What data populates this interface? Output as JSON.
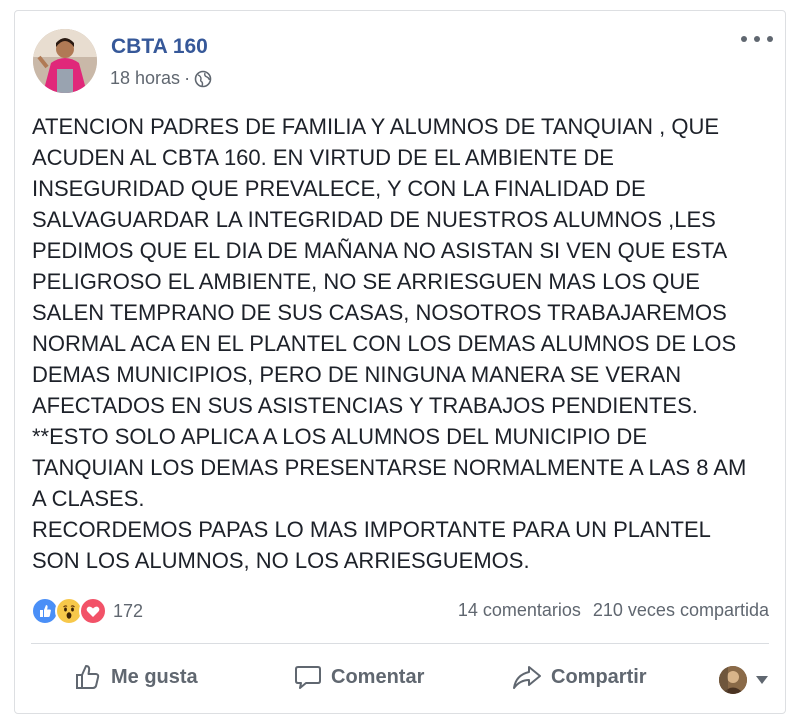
{
  "post": {
    "author": "CBTA 160",
    "time": "18 horas",
    "separator": "·",
    "privacy_icon": "globe-icon",
    "body_lines": [
      "ATENCION PADRES DE FAMILIA Y ALUMNOS DE TANQUIAN , QUE",
      "ACUDEN AL CBTA 160. EN VIRTUD DE EL AMBIENTE DE",
      "INSEGURIDAD QUE PREVALECE, Y CON LA FINALIDAD DE",
      "SALVAGUARDAR LA INTEGRIDAD DE NUESTROS ALUMNOS ,LES",
      "PEDIMOS QUE EL DIA DE MAÑANA NO ASISTAN SI VEN QUE ESTA",
      "PELIGROSO EL AMBIENTE, NO SE ARRIESGUEN MAS LOS QUE",
      "SALEN TEMPRANO DE SUS CASAS, NOSOTROS TRABAJAREMOS",
      "NORMAL ACA EN EL PLANTEL CON LOS DEMAS ALUMNOS DE LOS",
      "DEMAS MUNICIPIOS, PERO DE NINGUNA MANERA SE VERAN",
      "AFECTADOS EN SUS ASISTENCIAS Y TRABAJOS PENDIENTES.",
      "**ESTO SOLO APLICA A LOS ALUMNOS DEL MUNICIPIO DE",
      "TANQUIAN LOS DEMAS PRESENTARSE NORMALMENTE A LAS 8 AM",
      "A CLASES.",
      "RECORDEMOS PAPAS LO MAS IMPORTANTE PARA UN PLANTEL",
      "SON LOS ALUMNOS, NO LOS ARRIESGUEMOS."
    ]
  },
  "reactions": {
    "icons": [
      "like-reaction-icon",
      "wow-reaction-icon",
      "love-reaction-icon"
    ],
    "count": "172"
  },
  "stats": {
    "comments": "14 comentarios",
    "shares": "210 veces compartida"
  },
  "actions": {
    "like": "Me gusta",
    "comment": "Comentar",
    "share": "Compartir"
  },
  "colors": {
    "author": "#365899",
    "secondary_text": "#606770",
    "like_blue": "#4a8ff7",
    "wow_yellow": "#f7c84a",
    "love_red": "#f25268"
  }
}
